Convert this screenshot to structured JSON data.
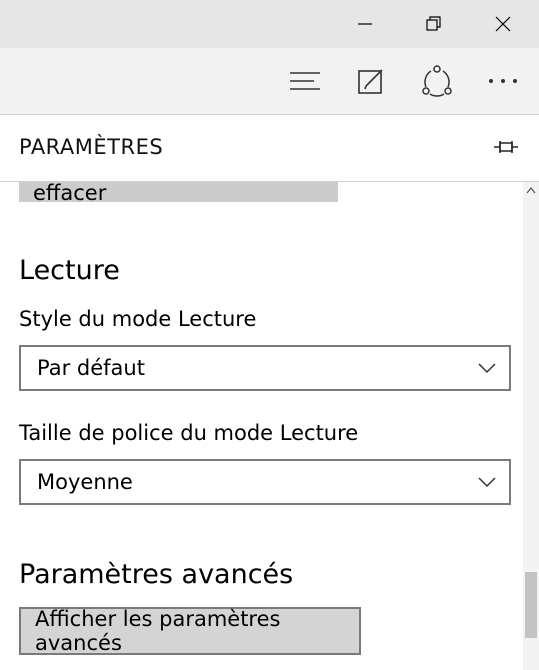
{
  "window": {
    "minimize_icon": "minimize-icon",
    "restore_icon": "restore-icon",
    "close_icon": "close-icon"
  },
  "toolbar": {
    "icons": [
      "hub-icon",
      "web-note-icon",
      "share-icon",
      "more-icon"
    ]
  },
  "panel": {
    "title": "PARAMÈTRES",
    "pin_icon": "pin-icon"
  },
  "content": {
    "clear_button_label": "Choisir les éléments à effacer",
    "reading_section_title": "Lecture",
    "reading_style_label": "Style du mode Lecture",
    "reading_style_value": "Par défaut",
    "reading_font_label": "Taille de police du mode Lecture",
    "reading_font_value": "Moyenne",
    "advanced_section_title": "Paramètres avancés",
    "advanced_button_label": "Afficher les paramètres avancés"
  },
  "colors": {
    "titlebar": "#e6e6e6",
    "toolbar": "#f2f2f2",
    "button_grey": "#cccccc",
    "border": "#7a7a7a"
  },
  "scroll_position": 0.92
}
